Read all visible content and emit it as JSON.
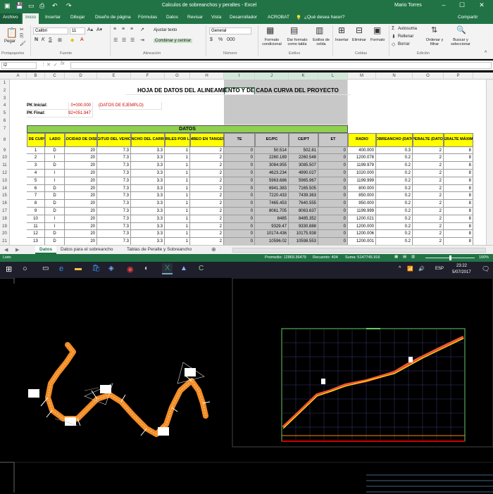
{
  "window": {
    "title": "Calculos de sobreanchos y peraltes  -  Excel",
    "user": "Mario Torres"
  },
  "tabs": [
    "Archivo",
    "Inicio",
    "Insertar",
    "Dibujar",
    "Diseño de página",
    "Fórmulas",
    "Datos",
    "Revisar",
    "Vista",
    "Desarrollador",
    "ACROBAT"
  ],
  "tell_me": "¿Qué desea hacer?",
  "share": "Compartir",
  "ribbon": {
    "paste": "Pegar",
    "font_name": "Calibri",
    "font_size": "11",
    "wrap": "Ajustar texto",
    "merge": "Combinar y centrar",
    "number_format": "General",
    "cond_format": "Formato condicional",
    "format_table": "Dar formato como tabla",
    "cell_styles": "Estilos de celda",
    "insert": "Insertar",
    "delete": "Eliminar",
    "format": "Formato",
    "autosum": "Autosuma",
    "fill": "Rellenar",
    "clear": "Borrar",
    "sort": "Ordenar y filtrar",
    "find": "Buscar y seleccionar",
    "groups": [
      "Portapapeles",
      "Fuente",
      "Alineación",
      "Número",
      "Estilos",
      "Celdas",
      "Edición"
    ]
  },
  "namebox": "I2",
  "columns": [
    "A",
    "B",
    "C",
    "D",
    "E",
    "F",
    "G",
    "H",
    "I",
    "J",
    "K",
    "L",
    "M",
    "N",
    "O",
    "P"
  ],
  "sheet": {
    "title": "HOJA DE DATOS DEL ALINEAMIENTO Y DE CADA CURVA DEL PROYECTO",
    "pk_inicial_label": "PK Inicial:",
    "pk_inicial_value": "0+000.000",
    "pk_inicial_note": "(DATOS DE EJEMPLO)",
    "pk_final_label": "PK Final:",
    "pk_final_value": "92+051.947",
    "datos_label": "DATOS",
    "headers": [
      "Nº DE CURVA",
      "LADO",
      "VELOCIDAD DE DISEÑO",
      "LONGITUD DEL VEHICULO",
      "ANCHO DEL CARRIL",
      "CARRILES POR LADO",
      "BOMBEO EN TANGENTE",
      "TE",
      "EC/PC",
      "CE/PT",
      "ET",
      "RADIO",
      "SOBREANCHO (DATO)",
      "PERALTE (DATO)",
      "PERALTE MÁXIMO"
    ],
    "rows": [
      [
        "1",
        "D",
        "20",
        "7.3",
        "3.3",
        "1",
        "2",
        "0",
        "50.514",
        "502.81",
        "0",
        "400.000",
        "0.3",
        "2",
        "8"
      ],
      [
        "2",
        "I",
        "20",
        "7.3",
        "3.3",
        "1",
        "2",
        "0",
        "2260.189",
        "2260.548",
        "0",
        "1200.078",
        "0.2",
        "2",
        "8"
      ],
      [
        "3",
        "D",
        "20",
        "7.3",
        "3.3",
        "1",
        "2",
        "0",
        "3084.955",
        "3085.507",
        "0",
        "1199.979",
        "0.2",
        "2",
        "8"
      ],
      [
        "4",
        "I",
        "20",
        "7.3",
        "3.3",
        "1",
        "2",
        "0",
        "4623.234",
        "4990.027",
        "0",
        "1020.000",
        "0.2",
        "2",
        "8"
      ],
      [
        "5",
        "I",
        "20",
        "7.3",
        "3.3",
        "1",
        "2",
        "0",
        "5963.686",
        "5965.967",
        "0",
        "1199.999",
        "0.2",
        "2",
        "8"
      ],
      [
        "6",
        "D",
        "20",
        "7.3",
        "3.3",
        "1",
        "2",
        "0",
        "6941.383",
        "7165.505",
        "0",
        "800.000",
        "0.2",
        "2",
        "8"
      ],
      [
        "7",
        "D",
        "20",
        "7.3",
        "3.3",
        "1",
        "2",
        "0",
        "7220.433",
        "7439.363",
        "0",
        "850.000",
        "0.2",
        "2",
        "8"
      ],
      [
        "8",
        "D",
        "20",
        "7.3",
        "3.3",
        "1",
        "2",
        "0",
        "7465.453",
        "7640.555",
        "0",
        "950.000",
        "0.2",
        "2",
        "8"
      ],
      [
        "9",
        "D",
        "20",
        "7.3",
        "3.3",
        "1",
        "2",
        "0",
        "8061.705",
        "8063.637",
        "0",
        "1199.999",
        "0.2",
        "2",
        "8"
      ],
      [
        "10",
        "I",
        "20",
        "7.3",
        "3.3",
        "1",
        "2",
        "0",
        "8485",
        "8485.352",
        "0",
        "1200.021",
        "0.2",
        "2",
        "8"
      ],
      [
        "11",
        "I",
        "20",
        "7.3",
        "3.3",
        "1",
        "2",
        "0",
        "9329.47",
        "9330.888",
        "0",
        "1200.000",
        "0.2",
        "2",
        "8"
      ],
      [
        "12",
        "D",
        "20",
        "7.3",
        "3.3",
        "1",
        "2",
        "0",
        "10174.436",
        "10175.938",
        "0",
        "1200.006",
        "0.2",
        "2",
        "8"
      ],
      [
        "13",
        "D",
        "20",
        "7.3",
        "3.3",
        "1",
        "2",
        "0",
        "10596.02",
        "10598.553",
        "0",
        "1200.001",
        "0.2",
        "2",
        "8"
      ],
      [
        "14",
        "D",
        "20",
        "7.3",
        "3.3",
        "1",
        "2",
        "0",
        "11011.606",
        "11102.532",
        "0",
        "1300.000",
        "0.2",
        "2",
        "8"
      ]
    ]
  },
  "sheet_tabs": [
    "Datos",
    "Datos para el sobreancho",
    "Tablas de Peralte y Sobreancho"
  ],
  "status": {
    "ready": "Listo",
    "average": "Promedio: 12869.36479",
    "count": "Recuento: 404",
    "sum": "Suma: 5147745.916",
    "zoom": "100%"
  },
  "taskbar": {
    "time": "23:22",
    "date": "5/07/2017",
    "lang": "ESP"
  },
  "colors": {
    "excel_green": "#217346",
    "header_yellow": "#ffff00",
    "gray_cols": "#c8c8c8",
    "cad_bg": "#000000",
    "alignment_orange": "#f28c28"
  }
}
